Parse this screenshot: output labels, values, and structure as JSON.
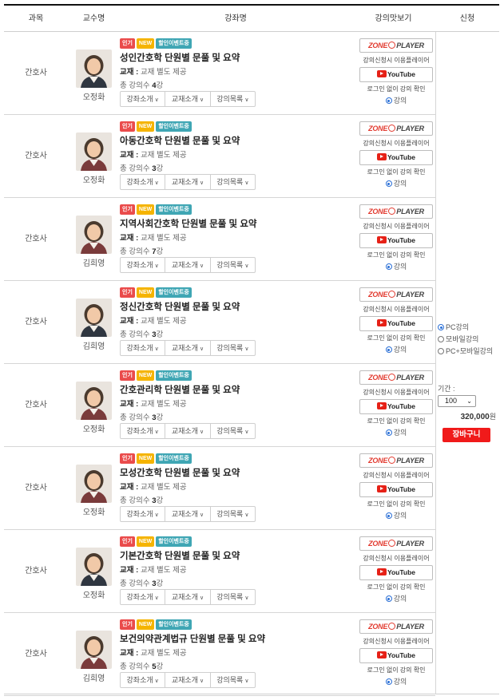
{
  "header": {
    "subject": "과목",
    "professor": "교수명",
    "course": "강좌명",
    "preview": "강의맛보기",
    "apply": "신청"
  },
  "badges": {
    "hot": "인기",
    "new": "NEW",
    "event": "할인이벤트중"
  },
  "labels": {
    "book_prefix": "교재 :",
    "book_value": "교재 별도 제공",
    "count_prefix": "총 강의수",
    "count_suffix": "강",
    "intro": "강좌소개",
    "textbook": "교재소개",
    "list": "강의목록",
    "zone_left": "ZONE",
    "zone_right": "PLAYER",
    "zone_note": "강의신청시 이용플레이어",
    "youtube": "YouTube",
    "yt_note": "로그인 없이 강의 확인",
    "lecture": "강의"
  },
  "rows": [
    {
      "subject": "간호사",
      "professor": "오정화",
      "title": "성인간호학 단원별 문풀 및 요약",
      "count": "4"
    },
    {
      "subject": "간호사",
      "professor": "오정화",
      "title": "아동간호학 단원별 문풀 및 요약",
      "count": "3"
    },
    {
      "subject": "간호사",
      "professor": "김희영",
      "title": "지역사회간호학 단원별 문풀 및 요약",
      "count": "7"
    },
    {
      "subject": "간호사",
      "professor": "김희영",
      "title": "정신간호학 단원별 문풀 및 요약",
      "count": "3"
    },
    {
      "subject": "간호사",
      "professor": "오정화",
      "title": "간호관리학 단원별 문풀 및 요약",
      "count": "3"
    },
    {
      "subject": "간호사",
      "professor": "오정화",
      "title": "모성간호학 단원별 문풀 및 요약",
      "count": "3"
    },
    {
      "subject": "간호사",
      "professor": "오정화",
      "title": "기본간호학 단원별 문풀 및 요약",
      "count": "3"
    },
    {
      "subject": "간호사",
      "professor": "김희영",
      "title": "보건의약관계법규 단원별 문풀 및 요약",
      "count": "5"
    }
  ],
  "apply": {
    "options": [
      "PC강의",
      "모바일강의",
      "PC+모바일강의"
    ],
    "selected_option": "PC강의",
    "period_label": "기간 :",
    "period_value": "100",
    "price": "320,000",
    "price_unit": "원",
    "cart_button": "장바구니"
  },
  "colors": {
    "hot": "#ea4b4b",
    "new": "#f5b400",
    "event": "#3fa6b4",
    "cart": "#f01a1a",
    "radio": "#2a6fd6"
  }
}
